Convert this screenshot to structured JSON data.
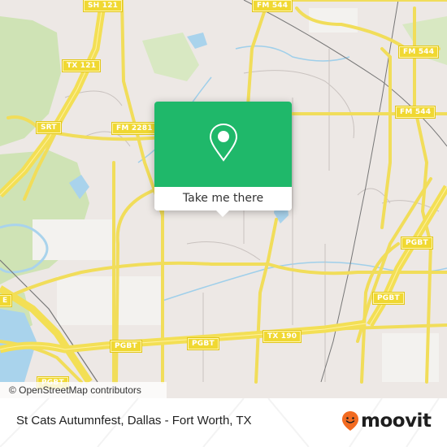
{
  "map": {
    "route_shields": [
      {
        "id": "sh121",
        "label": "SH 121"
      },
      {
        "id": "tx121",
        "label": "TX 121"
      },
      {
        "id": "srt",
        "label": "SRT"
      },
      {
        "id": "fm2281",
        "label": "FM 2281"
      },
      {
        "id": "fm544-top",
        "label": "FM 544"
      },
      {
        "id": "fm544-right",
        "label": "FM 544"
      },
      {
        "id": "fm544-mid",
        "label": "FM 544"
      },
      {
        "id": "pgbt-right-upper",
        "label": "PGBT"
      },
      {
        "id": "pgbt-right-lower",
        "label": "PGBT"
      },
      {
        "id": "pgbt-left",
        "label": "PGBT"
      },
      {
        "id": "pgbt-center",
        "label": "PGBT"
      },
      {
        "id": "tx190",
        "label": "TX 190"
      },
      {
        "id": "pgbt-bottom",
        "label": "PGBT"
      },
      {
        "id": "pgbt-edge",
        "label": "E"
      }
    ],
    "attribution": "© OpenStreetMap contributors"
  },
  "popup": {
    "icon": "map-pin-icon",
    "button_label": "Take me there",
    "accent_color": "#1fb86a"
  },
  "footer": {
    "title": "St Cats Autumnfest, Dallas - Fort Worth, TX",
    "brand": "moovit",
    "brand_color": "#f26b21"
  }
}
